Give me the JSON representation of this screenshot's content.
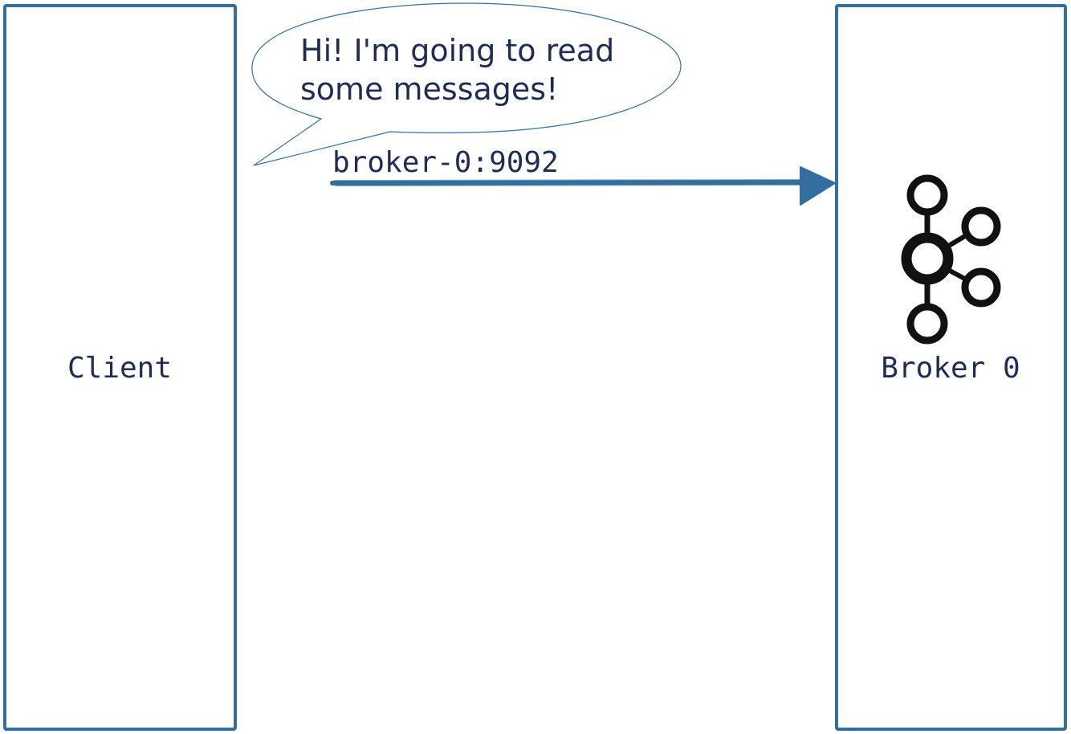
{
  "colors": {
    "box_border": "#336f9e",
    "arrow": "#336f9e",
    "text": "#1f2d55",
    "icon": "#111111",
    "bubble_border": "#336f9e"
  },
  "client": {
    "label": "Client"
  },
  "broker": {
    "label": "Broker 0",
    "icon": "kafka-logo-icon"
  },
  "connection": {
    "label": "broker-0:9092",
    "direction": "client-to-broker"
  },
  "speech_bubble": {
    "line1": "Hi! I'm going to read",
    "line2": "some messages!"
  }
}
